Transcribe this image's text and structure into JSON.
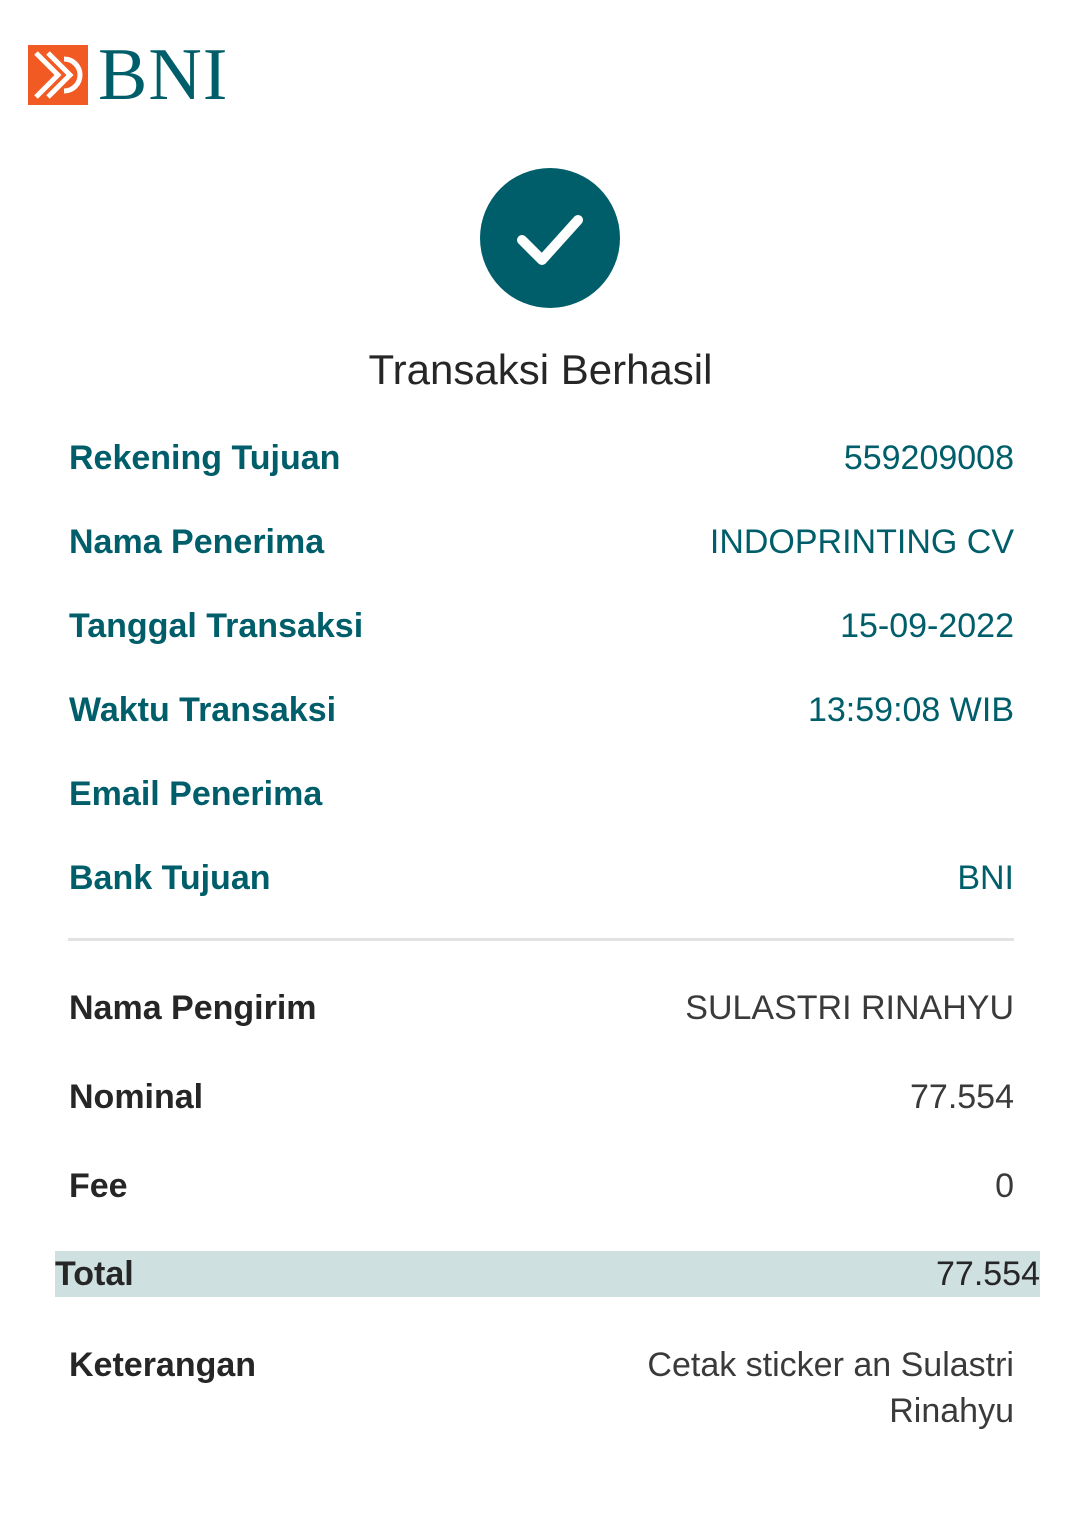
{
  "brand": {
    "name": "BNI",
    "primary_color": "#005e6a",
    "accent_color": "#f15a22",
    "logo_icon": "bni-logo-icon"
  },
  "status": {
    "icon": "checkmark-icon",
    "title": "Transaksi Berhasil"
  },
  "recipient_details": [
    {
      "label": "Rekening Tujuan",
      "value": "559209008"
    },
    {
      "label": "Nama Penerima",
      "value": "INDOPRINTING CV"
    },
    {
      "label": "Tanggal Transaksi",
      "value": "15-09-2022"
    },
    {
      "label": "Waktu Transaksi",
      "value": "13:59:08 WIB"
    },
    {
      "label": "Email Penerima",
      "value": ""
    },
    {
      "label": "Bank Tujuan",
      "value": "BNI"
    }
  ],
  "sender_details": [
    {
      "label": "Nama Pengirim",
      "value": "SULASTRI RINAHYU"
    },
    {
      "label": "Nominal",
      "value": "77.554"
    },
    {
      "label": "Fee",
      "value": "0"
    }
  ],
  "total": {
    "label": "Total",
    "value": "77.554"
  },
  "note": {
    "label": "Keterangan",
    "value": "Cetak sticker an Sulastri Rinahyu"
  }
}
